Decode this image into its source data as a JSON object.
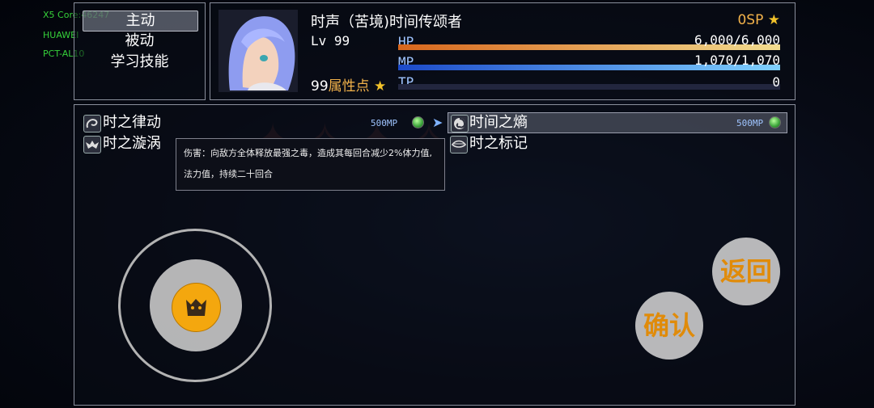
{
  "debug": {
    "line1": "X5 Core:46247",
    "line2": "HUAWEI",
    "line3": "PCT-AL10"
  },
  "menu": {
    "items": [
      {
        "label": "主动",
        "selected": true
      },
      {
        "label": "被动",
        "selected": false
      },
      {
        "label": "学习技能",
        "selected": false
      }
    ]
  },
  "status": {
    "name": "时声（苦境)时间传颂者",
    "level_label": "Lv",
    "level": "99",
    "attr_points": "99",
    "attr_label": "属性点",
    "sp": "0SP",
    "hp": {
      "label": "HP",
      "value": "6,000/6,000",
      "fraction": 1.0,
      "color_from": "#d8661c",
      "color_to": "#f2dc8f"
    },
    "mp": {
      "label": "MP",
      "value": "1,070/1,070",
      "fraction": 1.0,
      "color_from": "#1c4ac9",
      "color_to": "#7fd0ff"
    },
    "tp": {
      "label": "TP",
      "value": "0",
      "fraction": 0.0
    }
  },
  "skills": [
    {
      "name": "时之律动",
      "cost": "500MP",
      "icon": "swirl-icon"
    },
    {
      "name": "时间之熵",
      "cost": "500MP",
      "icon": "spiral-icon",
      "selected": true
    },
    {
      "name": "时之漩涡",
      "cost": "",
      "icon": "bat-icon"
    },
    {
      "name": "时之标记",
      "cost": "",
      "icon": "eye-icon"
    }
  ],
  "tooltip": {
    "line1": "伤害：向敌方全体释放最强之毒，造成其每回合减少2%体力值,",
    "line2": "法力值，持续二十回合"
  },
  "buttons": {
    "back": "返回",
    "confirm": "确认"
  },
  "colors": {
    "accent": "#e08b0a",
    "window_border": "#8a8f9c"
  }
}
